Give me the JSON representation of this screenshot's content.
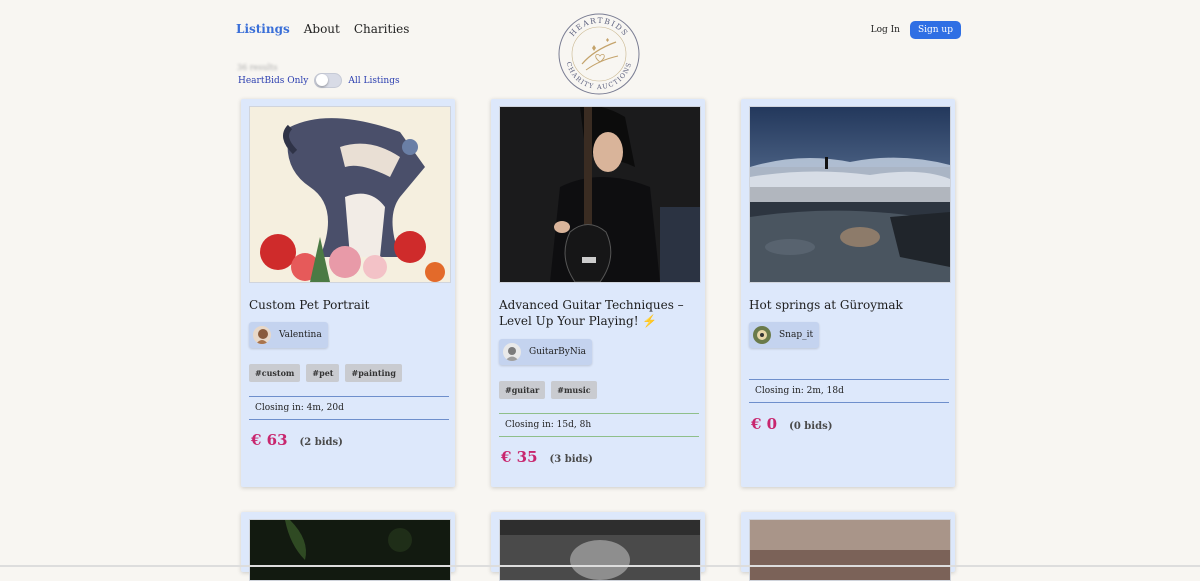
{
  "nav": {
    "links": [
      "Listings",
      "About",
      "Charities"
    ],
    "login": "Log In",
    "signup": "Sign up"
  },
  "logo": {
    "top_text": "HEARTBIDS",
    "bottom_text": "CHARITY AUCTIONS"
  },
  "filters": {
    "results_text": "36 results",
    "left_label": "HeartBids Only",
    "right_label": "All Listings"
  },
  "listings": [
    {
      "title": "Custom Pet Portrait",
      "seller": "Valentina",
      "tags": [
        "#custom",
        "#pet",
        "#painting"
      ],
      "closing": "Closing in: 4m, 20d",
      "price": "€ 63",
      "bids": "(2 bids)"
    },
    {
      "title": "Advanced Guitar Techniques – Level Up Your Playing! ⚡",
      "seller": "GuitarByNia",
      "tags": [
        "#guitar",
        "#music"
      ],
      "closing": "Closing in: 15d, 8h",
      "price": "€ 35",
      "bids": "(3 bids)"
    },
    {
      "title": "Hot springs at Güroymak",
      "seller": "Snap_it",
      "tags": [],
      "closing": "Closing in: 2m, 18d",
      "price": "€ 0",
      "bids": "(0 bids)"
    }
  ],
  "colors": {
    "accent": "#2f6fe4",
    "price": "#c8266e",
    "card_bg": "#dde8fb"
  }
}
